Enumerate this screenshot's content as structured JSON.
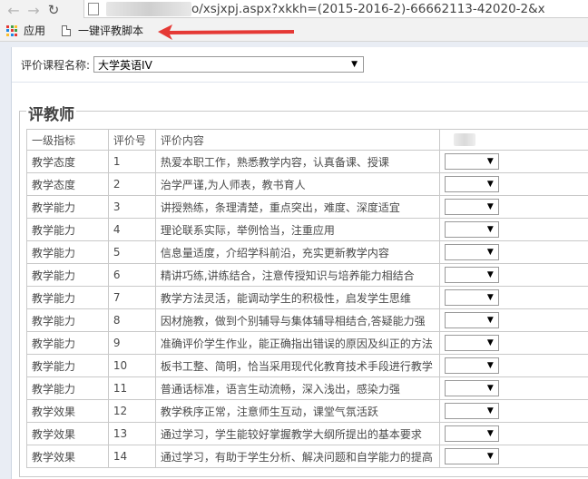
{
  "browser": {
    "url_text": "o/xsjxpj.aspx?xkkh=(2015-2016-2)-66662113-42020-2&x",
    "bookmarks": {
      "apps_label": "应用",
      "script_label": "一键评教脚本"
    },
    "colors": {
      "arrow": "#e53935"
    }
  },
  "form": {
    "course_label": "评价课程名称:",
    "course_value": "大学英语IV"
  },
  "section": {
    "title": "评教师",
    "columns": [
      "一级指标",
      "评价号",
      "评价内容"
    ],
    "rows": [
      {
        "category": "教学态度",
        "no": "1",
        "content": "热爱本职工作，熟悉教学内容，认真备课、授课"
      },
      {
        "category": "教学态度",
        "no": "2",
        "content": "治学严谨,为人师表，教书育人"
      },
      {
        "category": "教学能力",
        "no": "3",
        "content": "讲授熟练，条理清楚，重点突出，难度、深度适宜"
      },
      {
        "category": "教学能力",
        "no": "4",
        "content": "理论联系实际，举例恰当，注重应用"
      },
      {
        "category": "教学能力",
        "no": "5",
        "content": "信息量适度，介绍学科前沿，充实更新教学内容"
      },
      {
        "category": "教学能力",
        "no": "6",
        "content": "精讲巧练,讲练结合，注意传授知识与培养能力相结合"
      },
      {
        "category": "教学能力",
        "no": "7",
        "content": "教学方法灵活，能调动学生的积极性，启发学生思维"
      },
      {
        "category": "教学能力",
        "no": "8",
        "content": "因材施教，做到个别辅导与集体辅导相结合,答疑能力强"
      },
      {
        "category": "教学能力",
        "no": "9",
        "content": "准确评价学生作业，能正确指出错误的原因及纠正的方法"
      },
      {
        "category": "教学能力",
        "no": "10",
        "content": "板书工整、简明，恰当采用现代化教育技术手段进行教学"
      },
      {
        "category": "教学能力",
        "no": "11",
        "content": "普通话标准，语言生动流畅，深入浅出，感染力强"
      },
      {
        "category": "教学效果",
        "no": "12",
        "content": "教学秩序正常，注意师生互动，课堂气氛活跃"
      },
      {
        "category": "教学效果",
        "no": "13",
        "content": "通过学习，学生能较好掌握教学大纲所提出的基本要求"
      },
      {
        "category": "教学效果",
        "no": "14",
        "content": "通过学习，有助于学生分析、解决问题和自学能力的提高"
      }
    ]
  }
}
